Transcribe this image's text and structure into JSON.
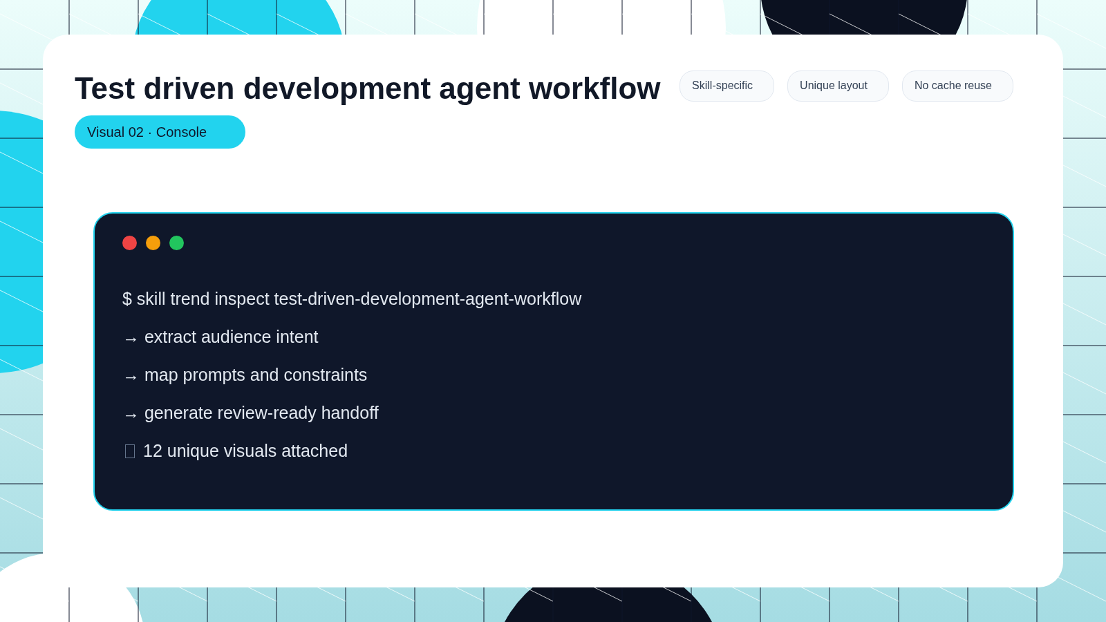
{
  "title": "Test driven development agent workflow",
  "badge": "Visual 02 · Console",
  "chips": [
    "Skill-specific",
    "Unique layout",
    "No cache reuse"
  ],
  "console": {
    "dots": [
      {
        "color": "#ef4444"
      },
      {
        "color": "#f59e0b"
      },
      {
        "color": "#22c55e"
      }
    ],
    "lines": [
      {
        "kind": "command",
        "text": "$ skill trend inspect test-driven-development-agent-workflow"
      },
      {
        "kind": "step",
        "text": "→ extract audience intent"
      },
      {
        "kind": "step",
        "text": "→ map prompts and constraints"
      },
      {
        "kind": "step",
        "text": "→ generate review-ready handoff"
      },
      {
        "kind": "missing-glyph",
        "text": "12 unique visuals attached"
      }
    ]
  }
}
